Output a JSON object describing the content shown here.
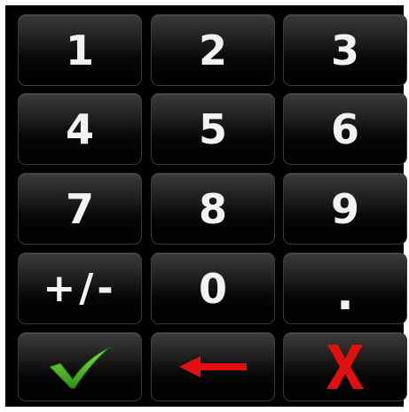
{
  "keypad": {
    "keys": [
      "1",
      "2",
      "3",
      "4",
      "5",
      "6",
      "7",
      "8",
      "9",
      "+/-",
      "0",
      "."
    ],
    "actions": {
      "confirm_icon": "check-icon",
      "backspace_icon": "arrow-left-icon",
      "cancel_icon": "x-icon"
    }
  },
  "colors": {
    "background": "#000000",
    "key_text": "#f2f2f2",
    "confirm": "#4caf2a",
    "backspace": "#e01010",
    "cancel": "#e01010"
  }
}
